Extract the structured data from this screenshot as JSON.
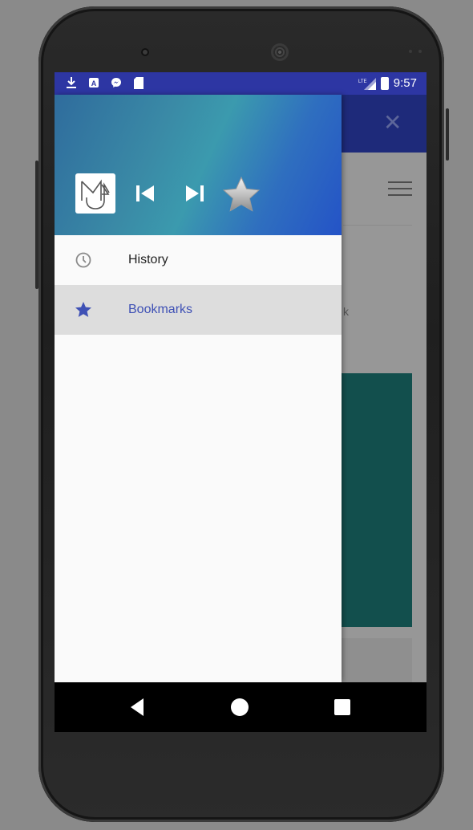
{
  "status_bar": {
    "time": "9:57",
    "network": "LTE",
    "icons": [
      "download-icon",
      "a-icon",
      "messenger-icon",
      "sd-card-icon",
      "signal-icon",
      "battery-icon"
    ]
  },
  "drawer": {
    "header_icons": [
      "app-logo-icon",
      "skip-previous-icon",
      "skip-next-icon",
      "star-icon"
    ],
    "items": [
      {
        "label": "History",
        "icon": "history-icon",
        "active": false
      },
      {
        "label": "Bookmarks",
        "icon": "bookmark-star-icon",
        "active": true
      }
    ]
  },
  "background": {
    "partial_text": "k",
    "icons": [
      "close-icon",
      "menu-icon"
    ]
  },
  "navigation_bar": {
    "buttons": [
      "back-button",
      "home-button",
      "recents-button"
    ]
  },
  "colors": {
    "status_bar": "#2d36a3",
    "accent": "#3f51b5",
    "card": "#124f4d"
  }
}
